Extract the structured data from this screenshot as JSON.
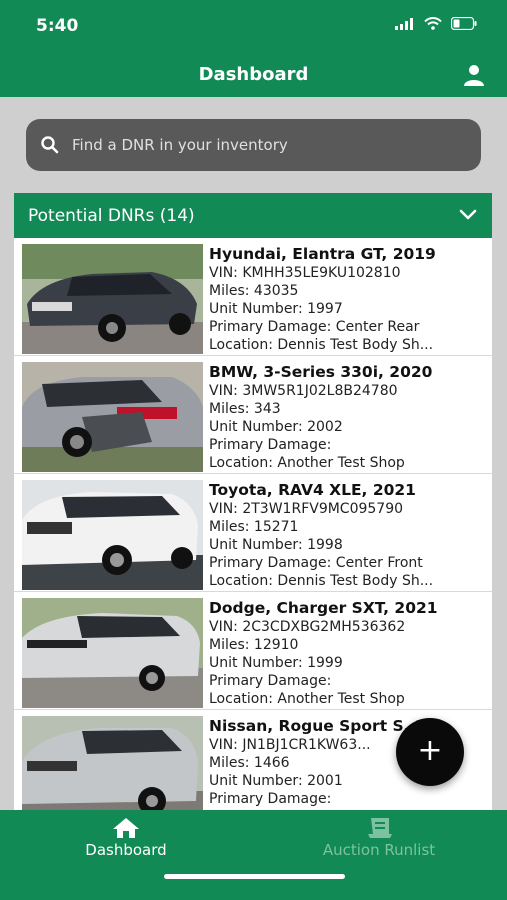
{
  "status_bar": {
    "time": "5:40"
  },
  "header": {
    "title": "Dashboard"
  },
  "search": {
    "placeholder": "Find a DNR in your inventory"
  },
  "section": {
    "title": "Potential DNRs (14)"
  },
  "vehicles": [
    {
      "name": "Hyundai, Elantra GT, 2019",
      "vin": "VIN: KMHH35LE9KU102810",
      "miles": "Miles: 43035",
      "unit": "Unit Number: 1997",
      "damage": "Primary Damage: Center Rear",
      "location": "Location: Dennis Test Body Sh..."
    },
    {
      "name": "BMW, 3-Series 330i, 2020",
      "vin": "VIN: 3MW5R1J02L8B24780",
      "miles": "Miles: 343",
      "unit": "Unit Number: 2002",
      "damage": "Primary Damage:",
      "location": "Location: Another Test Shop"
    },
    {
      "name": "Toyota, RAV4 XLE, 2021",
      "vin": "VIN: 2T3W1RFV9MC095790",
      "miles": "Miles: 15271",
      "unit": "Unit Number: 1998",
      "damage": "Primary Damage: Center Front",
      "location": "Location: Dennis Test Body Sh..."
    },
    {
      "name": "Dodge, Charger SXT, 2021",
      "vin": "VIN: 2C3CDXBG2MH536362",
      "miles": "Miles: 12910",
      "unit": "Unit Number: 1999",
      "damage": "Primary Damage:",
      "location": "Location: Another Test Shop"
    },
    {
      "name": "Nissan, Rogue Sport S, 2...",
      "vin": "VIN: JN1BJ1CR1KW63...",
      "miles": "Miles: 1466",
      "unit": "Unit Number: 2001",
      "damage": "Primary Damage:",
      "location": ""
    }
  ],
  "fab": {
    "label": "+"
  },
  "tabs": [
    {
      "label": "Dashboard",
      "icon": "home-icon"
    },
    {
      "label": "Auction Runlist",
      "icon": "runlist-icon"
    }
  ],
  "colors": {
    "brand_green": "#128a55",
    "search_bg": "#595959",
    "fab": "#0a0a0a"
  }
}
